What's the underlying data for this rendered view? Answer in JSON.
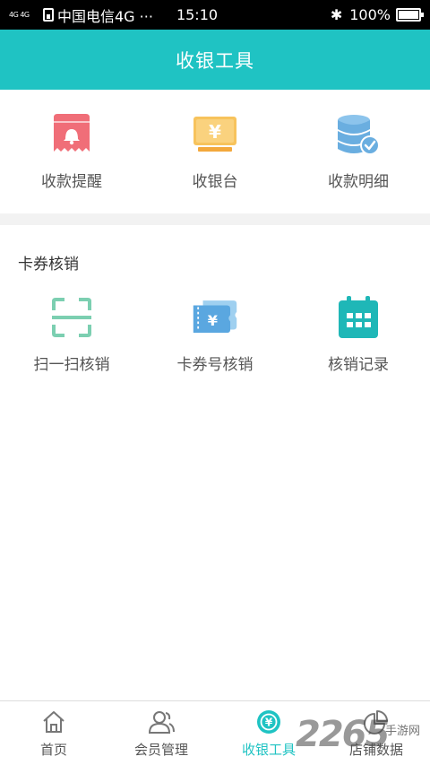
{
  "status_bar": {
    "signal": "4G 4G",
    "carrier": "中国电信4G ···",
    "time": "15:10",
    "bluetooth_icon": "bluetooth-icon",
    "battery": "100%"
  },
  "header": {
    "title": "收银工具"
  },
  "tools": [
    {
      "label": "收款提醒",
      "icon": "bell-receipt-icon",
      "color": "#f06e78"
    },
    {
      "label": "收银台",
      "icon": "cash-register-icon",
      "color": "#f7c35c"
    },
    {
      "label": "收款明细",
      "icon": "database-check-icon",
      "color": "#6aaee0"
    }
  ],
  "coupon": {
    "title": "卡券核销",
    "items": [
      {
        "label": "扫一扫核销",
        "icon": "scan-frame-icon",
        "color": "#7ccfb1"
      },
      {
        "label": "卡券号核销",
        "icon": "ticket-icon",
        "color": "#5aa7e0"
      },
      {
        "label": "核销记录",
        "icon": "calendar-icon",
        "color": "#1fb7b7"
      }
    ]
  },
  "tab_bar": {
    "items": [
      {
        "label": "首页",
        "icon": "home-icon"
      },
      {
        "label": "会员管理",
        "icon": "members-icon"
      },
      {
        "label": "收银工具",
        "icon": "cashier-tools-icon",
        "active": true
      },
      {
        "label": "店铺数据",
        "icon": "pie-chart-icon"
      }
    ]
  },
  "watermark": {
    "number": "2265",
    "text": "手游网"
  },
  "colors": {
    "accent": "#1fc3c3",
    "divider": "#f2f2f2"
  }
}
